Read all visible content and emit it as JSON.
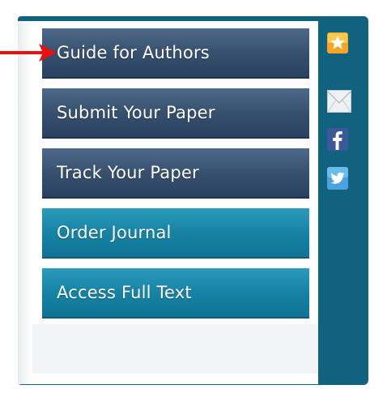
{
  "nav": {
    "items": [
      {
        "label": "Guide for Authors",
        "style": "dark"
      },
      {
        "label": "Submit Your Paper",
        "style": "dark"
      },
      {
        "label": "Track Your Paper",
        "style": "dark"
      },
      {
        "label": "Order Journal",
        "style": "teal"
      },
      {
        "label": "Access Full Text",
        "style": "teal"
      }
    ]
  },
  "social": {
    "icons": [
      "star-icon",
      "mail-icon",
      "facebook-icon",
      "twitter-icon"
    ]
  },
  "annotation": {
    "arrow_color": "#e81010",
    "arrow_target": "Guide for Authors"
  },
  "colors": {
    "panel": "#11627f",
    "dark_button": "#37506e",
    "teal_button": "#1783a4",
    "star_badge": "#f5a623",
    "facebook": "#3b5998",
    "twitter": "#4aa3df"
  }
}
